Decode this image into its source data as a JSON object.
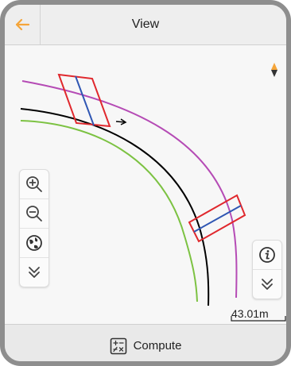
{
  "header": {
    "title": "View",
    "back_icon": "arrow-left-icon"
  },
  "map": {
    "compass_icon": "north-arrow-icon",
    "left_tools": [
      "zoom-in-icon",
      "zoom-out-icon",
      "globe-icon",
      "chevron-double-down-icon"
    ],
    "right_tools": [
      "info-icon",
      "chevron-double-down-icon"
    ],
    "scale_label": "43.01m"
  },
  "footer": {
    "compute_label": "Compute",
    "compute_icon": "calculator-icon"
  },
  "colors": {
    "accent": "#f5a53a",
    "centerline": "#000000",
    "left_offset": "#7cc242",
    "right_offset": "#b54bb5",
    "cross_section": "#e0282d",
    "section_axis": "#2f56b3"
  }
}
